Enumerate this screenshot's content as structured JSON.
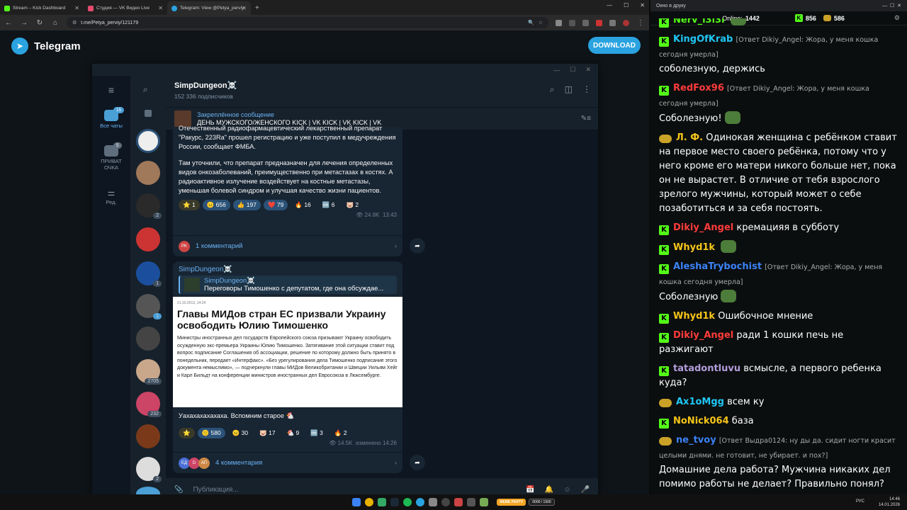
{
  "browser": {
    "tabs": [
      {
        "title": "Stream – Kick Dashboard",
        "color": "#53fc18"
      },
      {
        "title": "Студия — VK Видео Live",
        "color": "#e64a6f"
      },
      {
        "title": "Telegram: View @Petya_perviy",
        "color": "#2aa3e0"
      }
    ],
    "url": "t.me/Petya_perviy/121179"
  },
  "telegram": {
    "brand": "Telegram",
    "download_label": "DOWNLOAD",
    "folders": [
      {
        "label": "Все чаты",
        "badge": "15"
      },
      {
        "label": "ПРИВАТ ОЧКА",
        "badge": "5"
      },
      {
        "label": "Ред."
      }
    ],
    "chat_badges": [
      "2",
      "1",
      "1",
      "2705",
      "232",
      "2"
    ],
    "chat": {
      "name": "SimpDungeon☠️",
      "subscribers": "152 336 подписчиков"
    },
    "pinned": {
      "title": "Закреплённое сообщение",
      "text": "ДЕНЬ МУЖСКОГО/ЖЕНСКОГО  KICK | VK KICK | VK KICK | VK"
    },
    "msg1": {
      "text1": "Отечественный радиофармацевтический лекарственный препарат \"Ракурс, 223Ra\" прошел регистрацию и уже поступил в медучреждения России, сообщает ФМБА.",
      "text2": "Там уточнили, что препарат предназначен для лечения определенных видов онкозаболеваний, преимущественно при метастазах в костях. А радиоактивное излучение воздействует на костные метастазы, уменьшая болевой синдром и улучшая качество жизни пациентов.",
      "reactions": [
        "⭐ 1",
        "😐 656",
        "👍 197",
        "❤️ 79",
        "🔥 16",
        "🆒 6",
        "🐷 2"
      ],
      "views": "24.8K",
      "time": "13:43",
      "comments": "1 комментарий"
    },
    "msg2": {
      "author": "SimpDungeon☠️",
      "reply_author": "SimpDungeon☠️",
      "reply_text": "Переговоры Тимошенко с депутатом, где она обсуждае...",
      "img_date": "21.10.2013, 14:24",
      "img_title": "Главы МИДов стран ЕС призвали Украину освободить Юлию Тимошенко",
      "img_body": "Министры иностранных дел государств Европейского союза призывают Украину освободить осужденную экс-премьера Украины Юлию Тимошенко. Затягивание этой ситуации ставит под вопрос подписание Соглашения об ассоциации, решение по которому должно быть принято в понедельник, передает «Интерфакс». «Без урегулирования дела Тимошенко подписание этого документа немыслимо», — подчеркнули главы МИДов Великобритании и Швеции Уильям Хейг и Карл Бильдт на конференции министров иностранных дел Евросоюза в Люксембурге.",
      "text": "Уахахахахахаха. Вспомним старое 🐔",
      "reactions": [
        "⭐",
        "🙂 580",
        "😐 30",
        "🐷 17",
        "🐔 9",
        "🆒 3",
        "🔥 2"
      ],
      "views": "14.5K",
      "time": "изменено 14:26",
      "comments": "4 комментария"
    },
    "composer_placeholder": "Публикация..."
  },
  "kick": {
    "window_title": "Окно в друку",
    "online_label": "Online:",
    "online": "1442",
    "stat1": "856",
    "stat2": "586",
    "messages": [
      {
        "user": "Nerv_l3l3l",
        "color": "#53fc18",
        "reply": "",
        "text": "",
        "badge": true,
        "emote": true
      },
      {
        "user": "KingOfKrab",
        "color": "#1fc7f5",
        "reply": "[Ответ Dikiy_Angel: Жора, у меня кошка сегодня умерла]",
        "text": "соболезную, держись",
        "badge": true,
        "emote": false
      },
      {
        "user": "RedFox96",
        "color": "#ff3b3b",
        "reply": "[Ответ Dikiy_Angel: Жора, у меня кошка сегодня умерла]",
        "text": "Соболезную!",
        "badge": true,
        "emote": true
      },
      {
        "user": "Л. Ф.",
        "color": "#f5c518",
        "reply": "",
        "text": "Одинокая женщина с ребёнком ставит на первое место своего ребёнка, потому что у него кроме его матери никого больше нет, пока он не вырастет. В отличие от тебя взрослого зрелого мужчины, который может о себе позаботиться и за себя постоять.",
        "badge": false,
        "emote": false
      },
      {
        "user": "Dikiy_Angel",
        "color": "#ff3b3b",
        "reply": "",
        "text": "кремацияя в субботу",
        "badge": true,
        "emote": false
      },
      {
        "user": "Whyd1k",
        "color": "#f5c518",
        "reply": "",
        "text": "",
        "badge": true,
        "emote": true
      },
      {
        "user": "AleshaTrybochist",
        "color": "#3b82f6",
        "reply": "[Ответ Dikiy_Angel: Жора, у меня кошка сегодня умерла]",
        "text": "Соболезную",
        "badge": true,
        "emote": true
      },
      {
        "user": "Whyd1k",
        "color": "#f5c518",
        "reply": "",
        "text": "Ошибочное мнение",
        "badge": true,
        "emote": false
      },
      {
        "user": "Dikiy_Angel",
        "color": "#ff3b3b",
        "reply": "",
        "text": "ради 1 кошки печь не разжигают",
        "badge": true,
        "emote": false
      },
      {
        "user": "tatadontluvu",
        "color": "#b39ddb",
        "reply": "",
        "text": "всмысле, а первого ребенка куда?",
        "badge": true,
        "emote": false
      },
      {
        "user": "Ax1oMgg",
        "color": "#1fc7f5",
        "reply": "",
        "text": "всем ку",
        "badge": false,
        "emote": false
      },
      {
        "user": "NoNick064",
        "color": "#f5c518",
        "reply": "",
        "text": "база",
        "badge": true,
        "emote": false
      },
      {
        "user": "ne_tvoy",
        "color": "#3b82f6",
        "reply": "[Ответ Выдра0124: ну ды да. сидит ногти красит целыми днями. не готовит, не убирает. и пох?]",
        "text": "Домашние дела работа? Мужчина никаких дел помимо работы не делает? Правильно понял?",
        "badge": false,
        "emote": false
      }
    ]
  },
  "taskbar": {
    "lang": "РУС",
    "time": "14:46",
    "date": "14.01.2026",
    "meme_party": "MEME PARTY",
    "counter": "0000 / 1500"
  }
}
